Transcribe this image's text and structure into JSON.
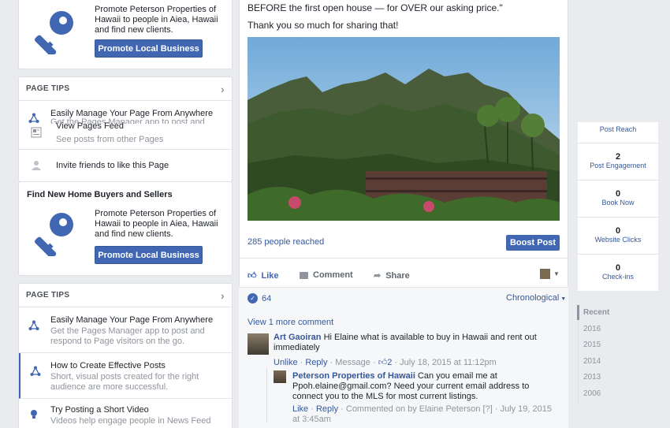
{
  "left": {
    "promo_top": {
      "text": "Promote Peterson Properties of Hawaii to people in Aiea, Hawaii and find new clients.",
      "button": "Promote Local Business"
    },
    "tips_1": {
      "header": "PAGE TIPS",
      "items": [
        {
          "title": "Easily Manage Your Page From Anywhere",
          "sub": "Get the Pages Manager app to post and"
        },
        {
          "title": "View Pages Feed",
          "sub": "See posts from other Pages"
        },
        {
          "title": "Invite friends to like this Page",
          "sub": ""
        }
      ]
    },
    "find_buyers": {
      "title": "Find New Home Buyers and Sellers",
      "text": "Promote Peterson Properties of Hawaii to people in Aiea, Hawaii and find new clients.",
      "button": "Promote Local Business"
    },
    "tips_2": {
      "header": "PAGE TIPS",
      "items": [
        {
          "title": "Easily Manage Your Page From Anywhere",
          "sub": "Get the Pages Manager app to post and respond to Page visitors on the go."
        },
        {
          "title": "How to Create Effective Posts",
          "sub": "Short, visual posts created for the right audience are more successful."
        },
        {
          "title": "Try Posting a Short Video",
          "sub": "Videos help engage people in News Feed"
        }
      ]
    }
  },
  "post": {
    "text_line1": "BEFORE the first open house — for OVER our asking price.\"",
    "text_line2": "Thank you so much for sharing that!",
    "reached": "285 people reached",
    "boost": "Boost Post",
    "actions": {
      "like": "Like",
      "comment": "Comment",
      "share": "Share"
    },
    "likes_count": "64",
    "order": "Chronological",
    "view_more": "View 1 more comment",
    "comment1": {
      "name": "Art Gaoiran",
      "text": "Hi Elaine what is available to buy in Hawaii and rent out immediately",
      "unlike": "Unlike",
      "reply": "Reply",
      "message": "Message",
      "likes": "2",
      "time": "July 18, 2015 at 11:12pm"
    },
    "reply1": {
      "name": "Peterson Properties of Hawaii",
      "text": "Can you email me at Ppoh.elaine@gmail.com? Need your current email address to connect you to the MLS for most current listings.",
      "like": "Like",
      "reply": "Reply",
      "commented_by": "Commented on by Elaine Peterson",
      "bracket": "[?]",
      "time": "July 19, 2015 at 3:45am"
    }
  },
  "stats": [
    {
      "num": "",
      "label": "Post Reach"
    },
    {
      "num": "2",
      "label": "Post Engagement"
    },
    {
      "num": "0",
      "label": "Book Now"
    },
    {
      "num": "0",
      "label": "Website Clicks"
    },
    {
      "num": "0",
      "label": "Check-ins"
    }
  ],
  "timeline": [
    "Recent",
    "2016",
    "2015",
    "2014",
    "2013",
    "2006"
  ],
  "colors": {
    "accent": "#4267b2",
    "link": "#365899",
    "bg": "#e9ebee"
  }
}
